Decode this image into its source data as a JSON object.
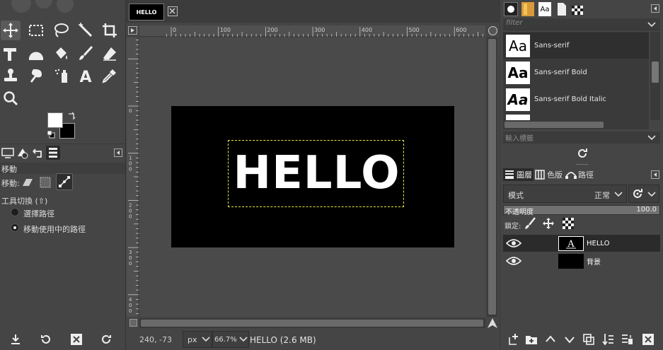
{
  "toolbox": {
    "tools": [
      "move-tool",
      "rect-select-tool",
      "lasso-tool",
      "fuzzy-select-tool",
      "crop-tool",
      "text-transform-tool",
      "warp-tool",
      "bucket-fill-tool",
      "paintbrush-tool",
      "eraser-tool",
      "clone-tool",
      "smudge-tool",
      "airbrush-tool",
      "text-tool",
      "color-picker-tool",
      "zoom-tool"
    ],
    "fg_color": "#ffffff",
    "bg_color": "#000000"
  },
  "tool_options": {
    "title": "移動",
    "move_label": "移動:",
    "toggle_label": "工具切換 (⇧)",
    "option_select_path": "選擇路徑",
    "option_move_active_path": "移動使用中的路徑"
  },
  "image_tab": {
    "label": "HELLO"
  },
  "canvas": {
    "text": "HELLO",
    "ruler_h": [
      "0",
      "100",
      "200",
      "300",
      "400",
      "500",
      "600"
    ],
    "ruler_v": [
      "0",
      "1 0 0",
      "2 0 0",
      "3 0 0",
      "4 0 0"
    ]
  },
  "status": {
    "coords": "240, -73",
    "unit": "px",
    "zoom": "66.7%",
    "image_info": "HELLO (2.6 MB)"
  },
  "fonts": {
    "filter_placeholder": "filter",
    "items": [
      {
        "thumb": "Aa",
        "name": "Sans-serif"
      },
      {
        "thumb": "Aa",
        "name": "Sans-serif Bold"
      },
      {
        "thumb": "Aa",
        "name": "Sans-serif Bold Italic"
      }
    ],
    "tag_placeholder": "輸入標籤"
  },
  "layers_panel": {
    "tabs": [
      "圖層",
      "色版",
      "路徑"
    ],
    "mode_label": "模式",
    "mode_value": "正常",
    "opacity_label": "不透明度",
    "opacity_value": "100.0",
    "lock_label": "鎖定:",
    "layers": [
      {
        "name": "HELLO",
        "type": "text"
      },
      {
        "name": "背景",
        "type": "fill"
      }
    ]
  }
}
